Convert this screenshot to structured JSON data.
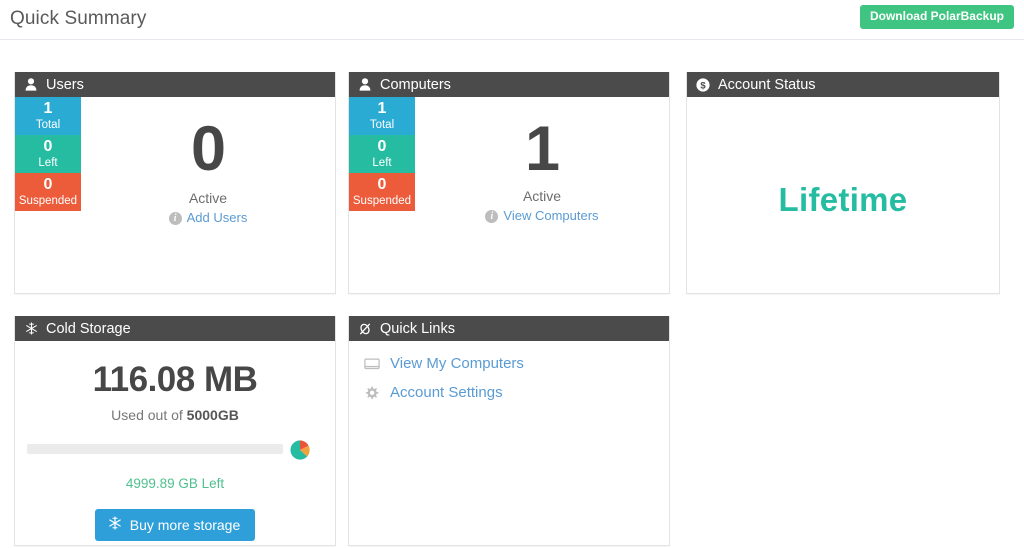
{
  "header": {
    "title": "Quick Summary",
    "download_button": "Download PolarBackup"
  },
  "panels": {
    "users": {
      "title": "Users",
      "icon": "user-icon",
      "tiles": [
        {
          "value": "1",
          "label": "Total",
          "color": "#29abd4"
        },
        {
          "value": "0",
          "label": "Left",
          "color": "#26bca2"
        },
        {
          "value": "0",
          "label": "Suspended",
          "color": "#ec5b3a"
        }
      ],
      "count": "0",
      "count_label": "Active",
      "link": "Add Users"
    },
    "computers": {
      "title": "Computers",
      "icon": "user-icon",
      "tiles": [
        {
          "value": "1",
          "label": "Total",
          "color": "#29abd4"
        },
        {
          "value": "0",
          "label": "Left",
          "color": "#26bca2"
        },
        {
          "value": "0",
          "label": "Suspended",
          "color": "#ec5b3a"
        }
      ],
      "count": "1",
      "count_label": "Active",
      "link": "View Computers"
    },
    "account_status": {
      "title": "Account Status",
      "icon": "dollar-circle-icon",
      "value": "Lifetime",
      "value_color": "#26bca2"
    },
    "cold_storage": {
      "title": "Cold Storage",
      "icon": "snowflake-icon",
      "used": "116.08 MB",
      "used_out_of_prefix": "Used out of ",
      "quota": "5000GB",
      "progress_percent": 0,
      "left": "4999.89 GB Left",
      "buy_button": "Buy more storage",
      "pie_segments": [
        {
          "color": "#26bca2",
          "percent": 55
        },
        {
          "color": "#e8563a",
          "percent": 24
        },
        {
          "color": "#f0a23c",
          "percent": 21
        }
      ]
    },
    "quick_links": {
      "title": "Quick Links",
      "icon": "link-icon",
      "items": [
        {
          "label": "View My Computers",
          "icon": "monitor-icon"
        },
        {
          "label": "Account Settings",
          "icon": "gear-icon"
        }
      ]
    }
  }
}
